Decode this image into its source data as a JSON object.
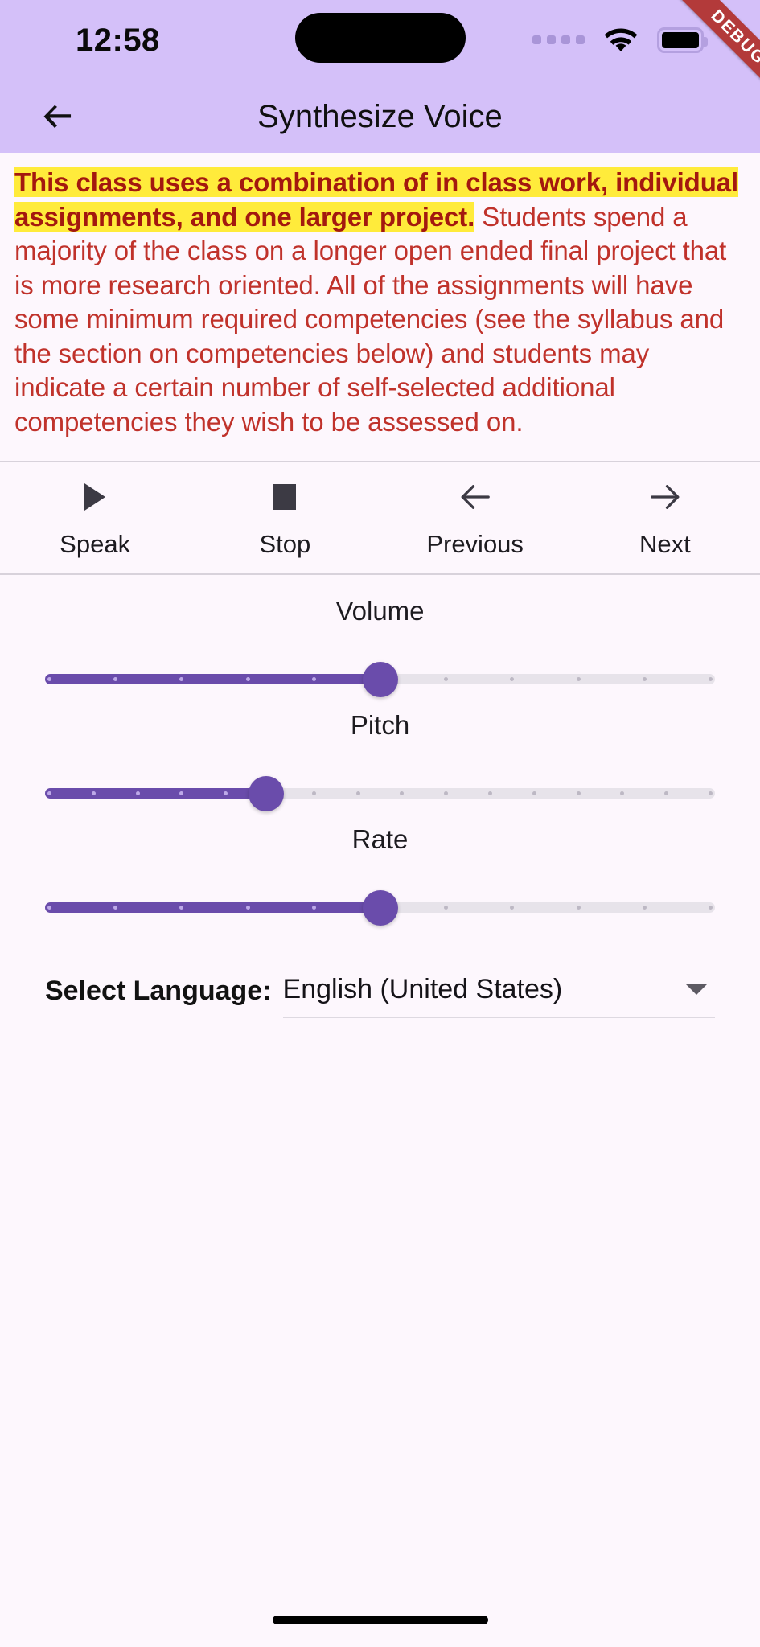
{
  "status_bar": {
    "time": "12:58",
    "signal_dots": 4,
    "wifi_icon": "wifi-icon",
    "battery_icon": "battery-full-icon"
  },
  "debug_banner": {
    "label": "DEBUG",
    "color": "#b33a3a"
  },
  "app_bar": {
    "back_icon": "arrow-left-icon",
    "title": "Synthesize Voice",
    "background": "#d4c0f9"
  },
  "content": {
    "highlighted_text": "This class uses a combination of in class work, individual assignments, and one larger project.",
    "rest_text": " Students spend a majority of the class on a longer open ended final project that is more research oriented. All of the assignments will have some minimum required competencies (see the syllabus and the section on competencies below) and students may indicate a certain number of self-selected additional competencies they wish to be assessed on.",
    "highlight_color": "#ffeb3b",
    "highlight_text_color": "#a3180f",
    "text_color": "#c0322b"
  },
  "controls": [
    {
      "label": "Speak",
      "icon": "play-icon"
    },
    {
      "label": "Stop",
      "icon": "stop-square-icon"
    },
    {
      "label": "Previous",
      "icon": "arrow-left-icon"
    },
    {
      "label": "Next",
      "icon": "arrow-right-icon"
    }
  ],
  "sliders": [
    {
      "label": "Volume",
      "percent": 50,
      "divisions": 10,
      "accent": "#6a4cab"
    },
    {
      "label": "Pitch",
      "percent": 33,
      "divisions": 15,
      "accent": "#6a4cab"
    },
    {
      "label": "Rate",
      "percent": 50,
      "divisions": 10,
      "accent": "#6a4cab"
    }
  ],
  "language": {
    "label": "Select Language:",
    "value": "English (United States)",
    "caret_icon": "chevron-down-icon"
  }
}
